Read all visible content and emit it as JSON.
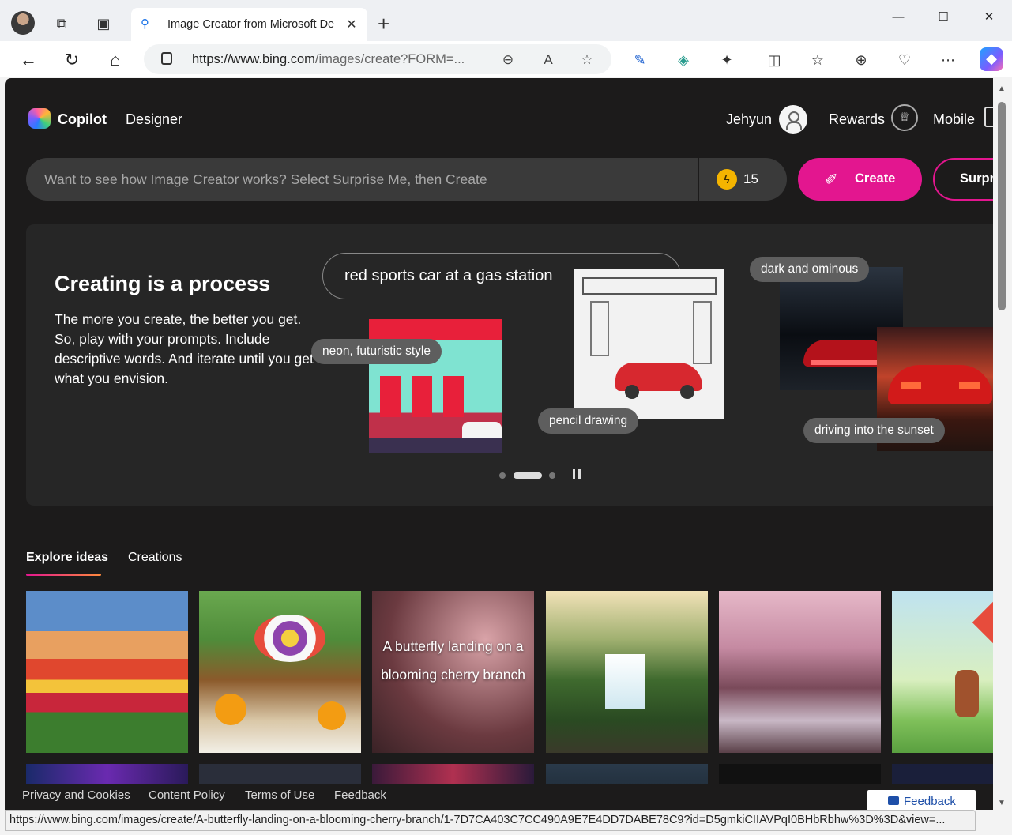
{
  "browser": {
    "tab_title": "Image Creator from Microsoft De",
    "url_host": "https://www.bing.com",
    "url_path": "/images/create?FORM=...",
    "status_url": "https://www.bing.com/images/create/A-butterfly-landing-on-a-blooming-cherry-branch/1-7D7CA403C7CC490A9E7E4DD7DABE78C9?id=D5gmkiCIIAVPqI0BHbRbhw%3D%3D&view=..."
  },
  "header": {
    "brand": "Copilot",
    "product": "Designer",
    "user_name": "Jehyun",
    "rewards_label": "Rewards",
    "mobile_label": "Mobile"
  },
  "prompt": {
    "placeholder": "Want to see how Image Creator works? Select Surprise Me, then Create",
    "boosts": "15",
    "create_label": "Create",
    "surprise_label": "Surprise Me"
  },
  "hero": {
    "title": "Creating is a process",
    "description": "The more you create, the better you get. So, play with your prompts. Include descriptive words. And iterate until you get what you envision.",
    "prompt_text": "red sports car at a gas station",
    "tags": {
      "neon": "neon, futuristic style",
      "pencil": "pencil drawing",
      "dark": "dark and ominous",
      "sunset": "driving into the sunset"
    }
  },
  "tabs": {
    "explore": "Explore ideas",
    "creations": "Creations"
  },
  "grid": {
    "butterfly_caption": "A butterfly landing on a blooming cherry branch"
  },
  "footer": {
    "privacy": "Privacy and Cookies",
    "content_policy": "Content Policy",
    "terms": "Terms of Use",
    "feedback": "Feedback",
    "feedback_button": "Feedback"
  },
  "colors": {
    "accent": "#e3168f",
    "page_bg": "#1c1b1b",
    "boost": "#f4b400"
  }
}
